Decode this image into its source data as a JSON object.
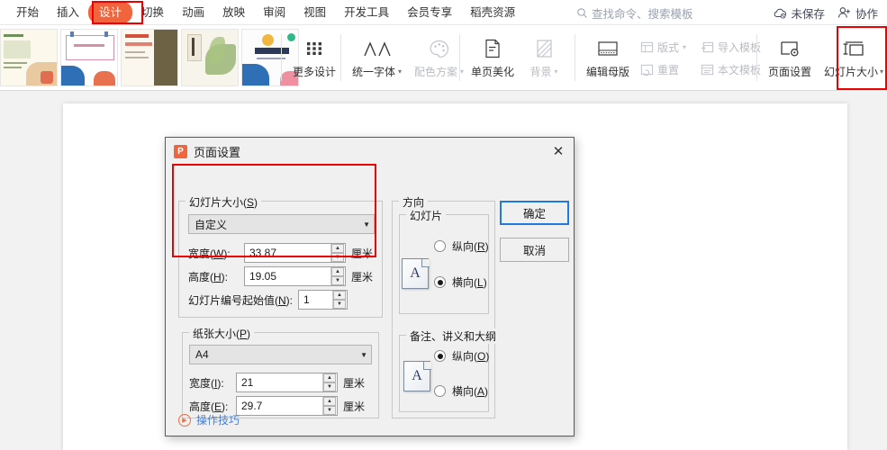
{
  "menubar": {
    "items": [
      {
        "label": "开始",
        "active": false
      },
      {
        "label": "插入",
        "active": false
      },
      {
        "label": "设计",
        "active": true
      },
      {
        "label": "切换",
        "active": false
      },
      {
        "label": "动画",
        "active": false
      },
      {
        "label": "放映",
        "active": false
      },
      {
        "label": "审阅",
        "active": false
      },
      {
        "label": "视图",
        "active": false
      },
      {
        "label": "开发工具",
        "active": false
      },
      {
        "label": "会员专享",
        "active": false
      },
      {
        "label": "稻壳资源",
        "active": false
      }
    ],
    "search_placeholder": "查找命令、搜索模板",
    "search_icon": "search-icon",
    "save_status": "未保存",
    "save_icon": "cloud-unsaved-icon",
    "collab_label": "协作",
    "collab_icon": "user-plus-icon"
  },
  "ribbon": {
    "more_design": {
      "label": "更多设计",
      "icon": "grid-icon"
    },
    "unify_font": {
      "label": "统一字体",
      "icon": "double-a-icon",
      "caret": "▾",
      "dim": false
    },
    "color_scheme": {
      "label": "配色方案",
      "icon": "palette-icon",
      "caret": "▾",
      "dim": true
    },
    "page_beautify": {
      "label": "单页美化",
      "icon": "document-icon",
      "dim": false
    },
    "background": {
      "label": "背景",
      "icon": "background-icon",
      "caret": "▾",
      "dim": true
    },
    "edit_master": {
      "label": "编辑母版",
      "icon": "master-icon",
      "dim": false
    },
    "layout": {
      "label": "版式",
      "icon": "layout-icon",
      "caret": "▾",
      "dim": true
    },
    "reset": {
      "label": "重置",
      "icon": "reset-icon",
      "dim": true
    },
    "import_template": {
      "label": "导入模板",
      "icon": "import-icon",
      "dim": true
    },
    "this_template": {
      "label": "本文模板",
      "icon": "template-icon",
      "dim": true
    },
    "page_setup": {
      "label": "页面设置",
      "icon": "page-setup-icon"
    },
    "slide_size": {
      "label": "幻灯片大小",
      "icon": "slide-size-icon",
      "caret": "▾"
    }
  },
  "dialog": {
    "title": "页面设置",
    "logo_text": "P",
    "close_icon": "close-icon",
    "slide_size_group": {
      "legend_prefix": "幻灯片大小(",
      "legend_key": "S",
      "legend_suffix": ")",
      "preset": "自定义",
      "width_label_prefix": "宽度(",
      "width_key": "W",
      "width_label_suffix": "):",
      "width_value": "33.87",
      "width_unit": "厘米",
      "height_label_prefix": "高度(",
      "height_key": "H",
      "height_label_suffix": "):",
      "height_value": "19.05",
      "height_unit": "厘米",
      "number_label_prefix": "幻灯片编号起始值(",
      "number_key": "N",
      "number_label_suffix": "):",
      "number_value": "1"
    },
    "paper_size_group": {
      "legend_prefix": "纸张大小(",
      "legend_key": "P",
      "legend_suffix": ")",
      "preset": "A4",
      "width_label_prefix": "宽度(",
      "width_key": "I",
      "width_label_suffix": "):",
      "width_value": "21",
      "width_unit": "厘米",
      "height_label_prefix": "高度(",
      "height_key": "E",
      "height_label_suffix": "):",
      "height_value": "29.7",
      "height_unit": "厘米"
    },
    "orientation_group": {
      "legend": "方向",
      "slide": {
        "legend": "幻灯片",
        "icon": "portrait-page-icon",
        "portrait_prefix": "纵向(",
        "portrait_key": "R",
        "portrait_suffix": ")",
        "portrait_selected": false,
        "landscape_prefix": "横向(",
        "landscape_key": "L",
        "landscape_suffix": ")",
        "landscape_selected": true
      },
      "notes": {
        "legend": "备注、讲义和大纲",
        "icon": "portrait-page-icon",
        "portrait_prefix": "纵向(",
        "portrait_key": "O",
        "portrait_suffix": ")",
        "portrait_selected": true,
        "landscape_prefix": "横向(",
        "landscape_key": "A",
        "landscape_suffix": ")",
        "landscape_selected": false
      }
    },
    "ok_button": "确定",
    "cancel_button": "取消",
    "tips_label": "操作技巧",
    "tips_icon": "play-circle-icon"
  },
  "colors": {
    "accent_orange": "#f2643c",
    "highlight_red": "#ee0000",
    "focus_blue": "#1e7ae0",
    "link_blue": "#4a7fd4"
  }
}
